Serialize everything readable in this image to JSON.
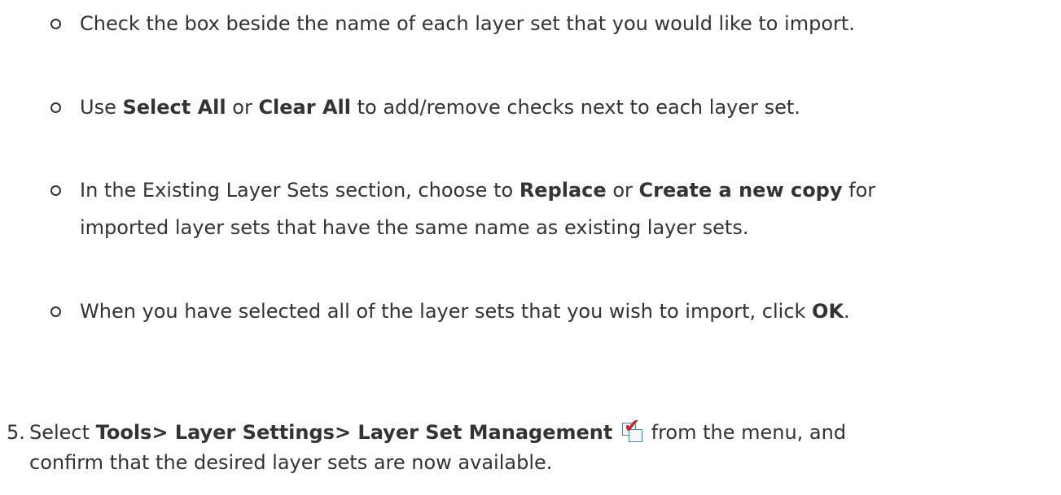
{
  "sub_items": [
    {
      "text": "Check the box beside the name of each layer set that you would like to import."
    },
    {
      "pre": "Use ",
      "b1": "Select All",
      "mid": " or ",
      "b2": "Clear All",
      "post": " to add/remove checks next to each layer set."
    },
    {
      "pre": "In the Existing Layer Sets section, choose to ",
      "b1": "Replace",
      "mid": " or ",
      "b2": "Create a new copy",
      "post": " for",
      "line2": "imported layer sets that have the same name as existing layer sets."
    },
    {
      "pre": "When you have selected all of the layer sets that you wish to import, click ",
      "b1": "OK",
      "post": "."
    }
  ],
  "step5": {
    "number": "5.",
    "pre": "Select ",
    "bold": "Tools> Layer Settings> Layer Set Management",
    "icon": "layer-set-management-icon",
    "post": " from the menu, and",
    "line2": "confirm that the desired layer sets are now available."
  }
}
